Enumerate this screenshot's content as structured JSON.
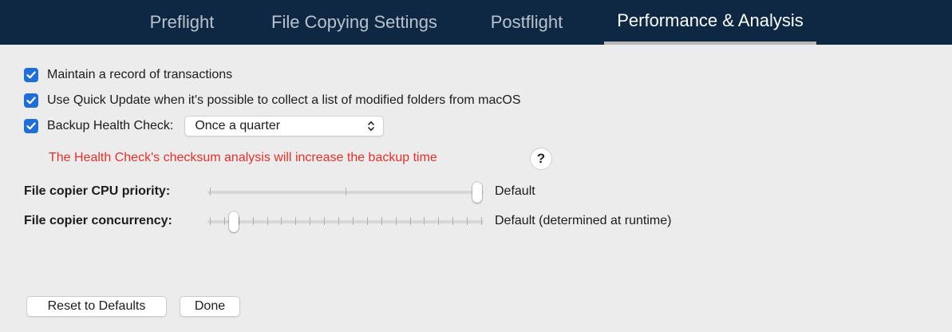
{
  "tabs": [
    {
      "label": "Preflight",
      "active": false
    },
    {
      "label": "File Copying Settings",
      "active": false
    },
    {
      "label": "Postflight",
      "active": false
    },
    {
      "label": "Performance & Analysis",
      "active": true
    }
  ],
  "options": {
    "transactions": {
      "label": "Maintain a record of transactions",
      "checked": true
    },
    "quick_update": {
      "label": "Use Quick Update when it's possible to collect a list of modified folders from macOS",
      "checked": true
    },
    "health_check": {
      "label": "Backup Health Check:",
      "checked": true,
      "selected": "Once a quarter"
    }
  },
  "warning": {
    "text": "The Health Check's checksum analysis will increase the backup time",
    "help_label": "?"
  },
  "sliders": {
    "cpu_priority": {
      "label": "File copier CPU priority:",
      "value_text": "Default",
      "tick_count": 3,
      "position": 1.0
    },
    "concurrency": {
      "label": "File copier concurrency:",
      "value_text": "Default (determined at runtime)",
      "tick_count": 20,
      "position": 0.075
    }
  },
  "buttons": {
    "reset": "Reset to Defaults",
    "done": "Done"
  },
  "colors": {
    "topbar": "#0e2843",
    "checkbox": "#1f6fd4",
    "warning": "#e5302b",
    "background": "#ececec"
  }
}
